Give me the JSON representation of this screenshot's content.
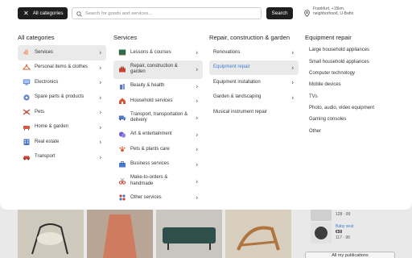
{
  "header": {
    "all_categories_label": "All categories",
    "search_placeholder": "Search for goods and services...",
    "search_button": "Search",
    "location_text": "Frankfurt, +15km, neighborhood, U-Bahn"
  },
  "menu": {
    "col1": {
      "title": "All categories",
      "items": [
        {
          "label": "Services",
          "icon": "hand-icon"
        },
        {
          "label": "Personal items & clothes",
          "icon": "hanger-icon"
        },
        {
          "label": "Electronics",
          "icon": "monitor-icon"
        },
        {
          "label": "Spare parts & products",
          "icon": "gear-icon"
        },
        {
          "label": "Pets",
          "icon": "paw-icon"
        },
        {
          "label": "Home & garden",
          "icon": "armchair-icon"
        },
        {
          "label": "Real estate",
          "icon": "building-icon"
        },
        {
          "label": "Transport",
          "icon": "car-icon"
        }
      ]
    },
    "col2": {
      "title": "Services",
      "items": [
        {
          "label": "Lessons & courses",
          "icon": "chalkboard-icon"
        },
        {
          "label": "Repair, construction & garden",
          "icon": "toolbox-icon"
        },
        {
          "label": "Beauty & health",
          "icon": "bottle-icon"
        },
        {
          "label": "Household services",
          "icon": "house-icon"
        },
        {
          "label": "Transport, transportation & delivery",
          "icon": "van-icon"
        },
        {
          "label": "Art & entertainment",
          "icon": "masks-icon"
        },
        {
          "label": "Pets & plants care",
          "icon": "paw-icon"
        },
        {
          "label": "Business services",
          "icon": "briefcase-icon"
        },
        {
          "label": "Make-to-orders & handmade",
          "icon": "scissors-icon"
        },
        {
          "label": "Other services",
          "icon": "grid-icon"
        }
      ]
    },
    "col3": {
      "title": "Repair, construction & garden",
      "items": [
        {
          "label": "Renovations"
        },
        {
          "label": "Equipment repair"
        },
        {
          "label": "Equipment installation"
        },
        {
          "label": "Garden & landscaping"
        },
        {
          "label": "Musical instrument repair"
        }
      ]
    },
    "col4": {
      "title": "Equipment repair",
      "items": [
        {
          "label": "Large household appliances"
        },
        {
          "label": "Small household appliances"
        },
        {
          "label": "Computer technology"
        },
        {
          "label": "Mobile devices"
        },
        {
          "label": "TVs"
        },
        {
          "label": "Photo, audio, video equipment"
        },
        {
          "label": "Gaming consoles"
        },
        {
          "label": "Other"
        }
      ]
    }
  },
  "sidebar": {
    "item1_meta": "128 · 99",
    "item2_title": "Baby seat",
    "item2_price": "€50",
    "item2_meta": "117 · 96",
    "my_publications": "All my publications"
  },
  "colors": {
    "accent_blue": "#3b7fd3",
    "dark_button": "#1e1e1e",
    "selected_bg": "#eaeaea"
  }
}
